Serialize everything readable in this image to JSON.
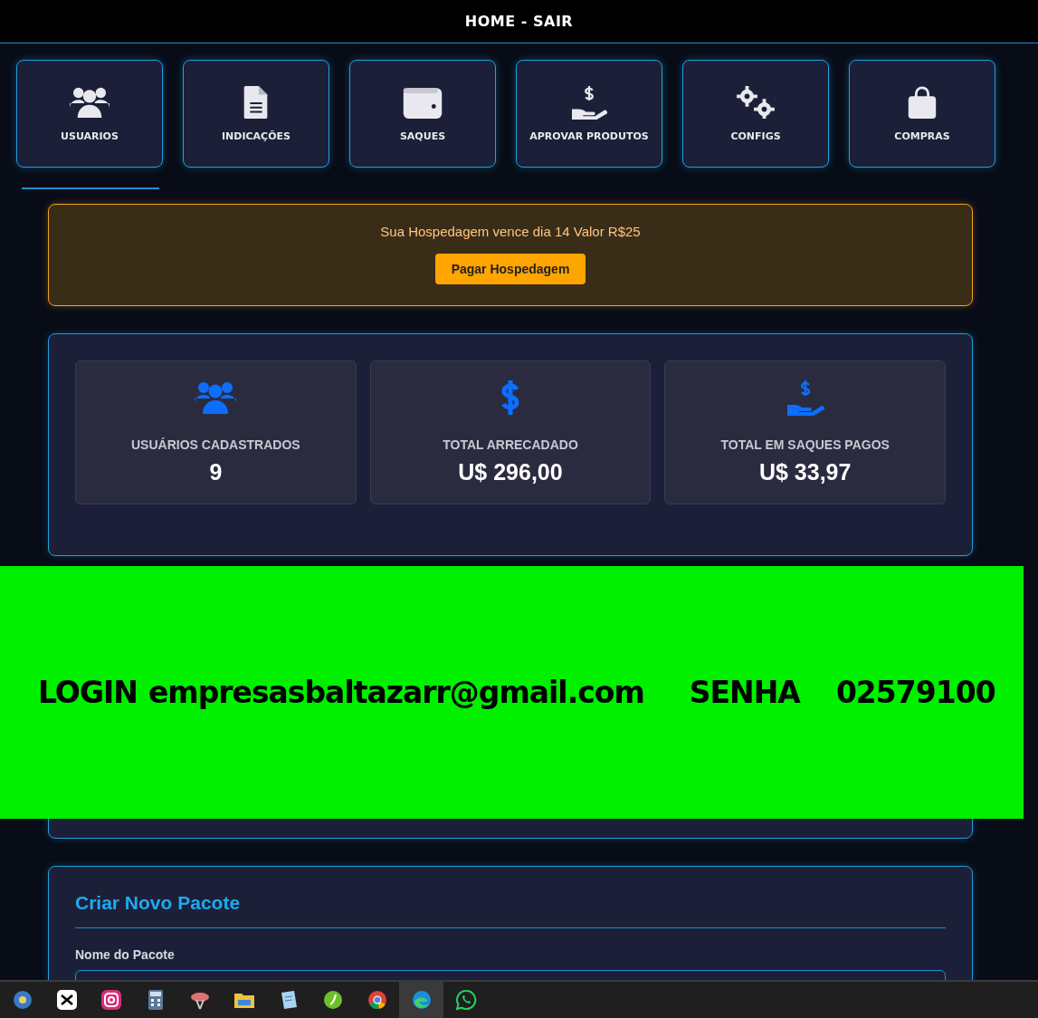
{
  "top_bar": {
    "title": "HOME - SAIR"
  },
  "nav_tiles": [
    {
      "kind": "users",
      "label": "USUARIOS"
    },
    {
      "kind": "document",
      "label": "INDICAÇÕES"
    },
    {
      "kind": "wallet",
      "label": "SAQUES"
    },
    {
      "kind": "hand-dollar",
      "label": "APROVAR PRODUTOS"
    },
    {
      "kind": "gears",
      "label": "CONFIGS"
    },
    {
      "kind": "bag",
      "label": "COMPRAS"
    }
  ],
  "hosting_alert": {
    "message": "Sua Hospedagem vence dia 14 Valor R$25",
    "button": "Pagar Hospedagem"
  },
  "stats": [
    {
      "kind": "users",
      "label": "USUÁRIOS CADASTRADOS",
      "value": "9"
    },
    {
      "kind": "dollar",
      "label": "TOTAL ARRECADADO",
      "value": "U$ 296,00"
    },
    {
      "kind": "hand-dollar",
      "label": "TOTAL EM SAQUES PAGOS",
      "value": "U$ 33,97"
    }
  ],
  "overlay_banner": {
    "login_label": "LOGIN",
    "login": "empresasbaltazarr@gmail.com",
    "password_label": "SENHA",
    "password": "02579100"
  },
  "create_package": {
    "title": "Criar Novo Pacote",
    "field_label": "Nome do Pacote"
  },
  "taskbar": [
    {
      "kind": "disc",
      "selected": false
    },
    {
      "kind": "capcut",
      "selected": false
    },
    {
      "kind": "camera",
      "selected": false
    },
    {
      "kind": "calculator",
      "selected": false
    },
    {
      "kind": "snip",
      "selected": false
    },
    {
      "kind": "folder",
      "selected": false
    },
    {
      "kind": "note",
      "selected": false
    },
    {
      "kind": "green-ball",
      "selected": false
    },
    {
      "kind": "chrome",
      "selected": false
    },
    {
      "kind": "edge",
      "selected": true
    },
    {
      "kind": "chat",
      "selected": false
    }
  ]
}
